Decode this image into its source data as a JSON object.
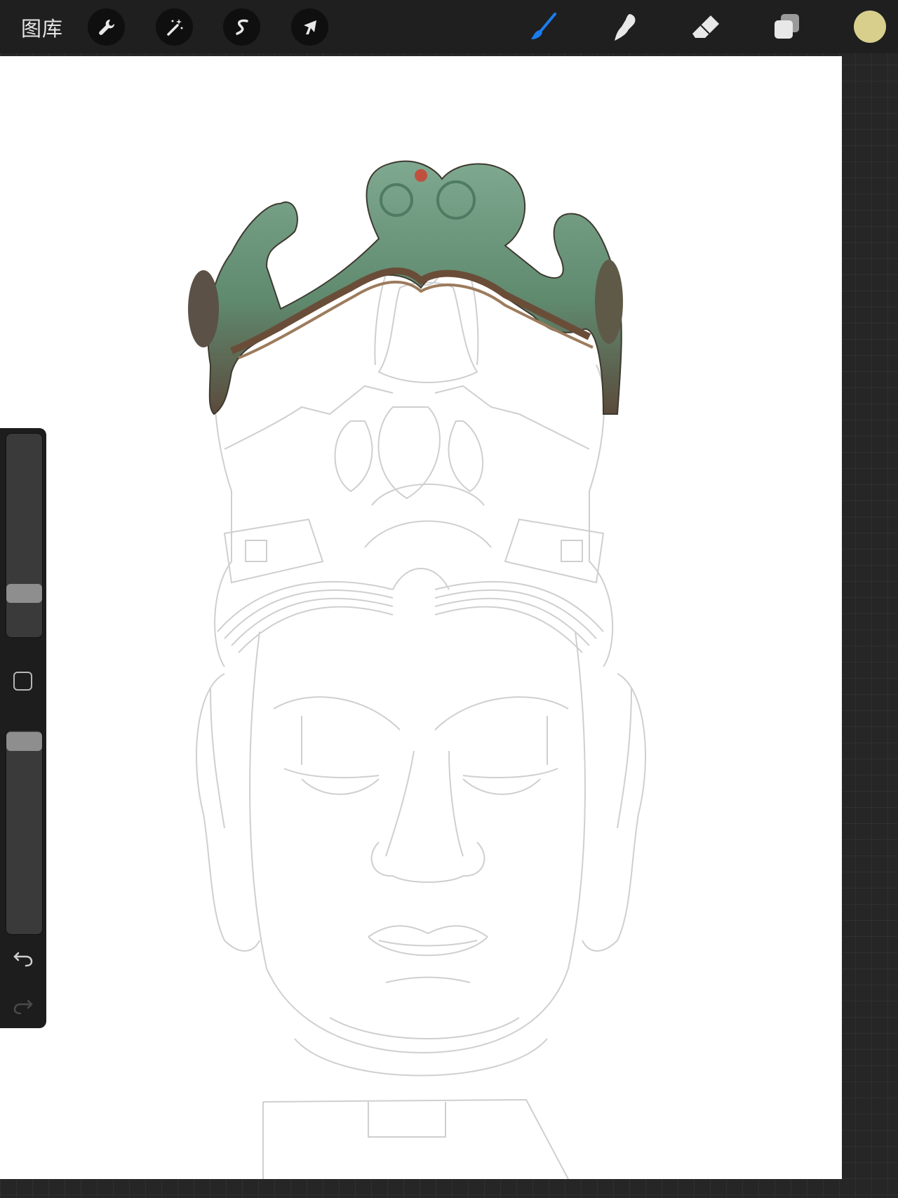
{
  "toolbar": {
    "gallery_label": "图库",
    "left_tools": [
      {
        "name": "actions",
        "icon": "wrench-icon"
      },
      {
        "name": "adjustments",
        "icon": "magic-wand-icon"
      },
      {
        "name": "selection",
        "icon": "selection-s-icon"
      },
      {
        "name": "transform",
        "icon": "arrow-cursor-icon"
      }
    ],
    "right_tools": [
      {
        "name": "brush",
        "icon": "brush-icon",
        "active": true
      },
      {
        "name": "smudge",
        "icon": "smudge-icon",
        "active": false
      },
      {
        "name": "eraser",
        "icon": "eraser-icon",
        "active": false
      },
      {
        "name": "layers",
        "icon": "layers-icon",
        "active": false
      }
    ],
    "active_color": "#d8cf8c",
    "accent_color": "#1a7cf0"
  },
  "sidebar": {
    "brush_size_level": 0.21,
    "opacity_level": 1.0,
    "modify_icon": "square-modify-icon",
    "undo_icon": "undo-icon",
    "redo_icon": "redo-icon"
  }
}
